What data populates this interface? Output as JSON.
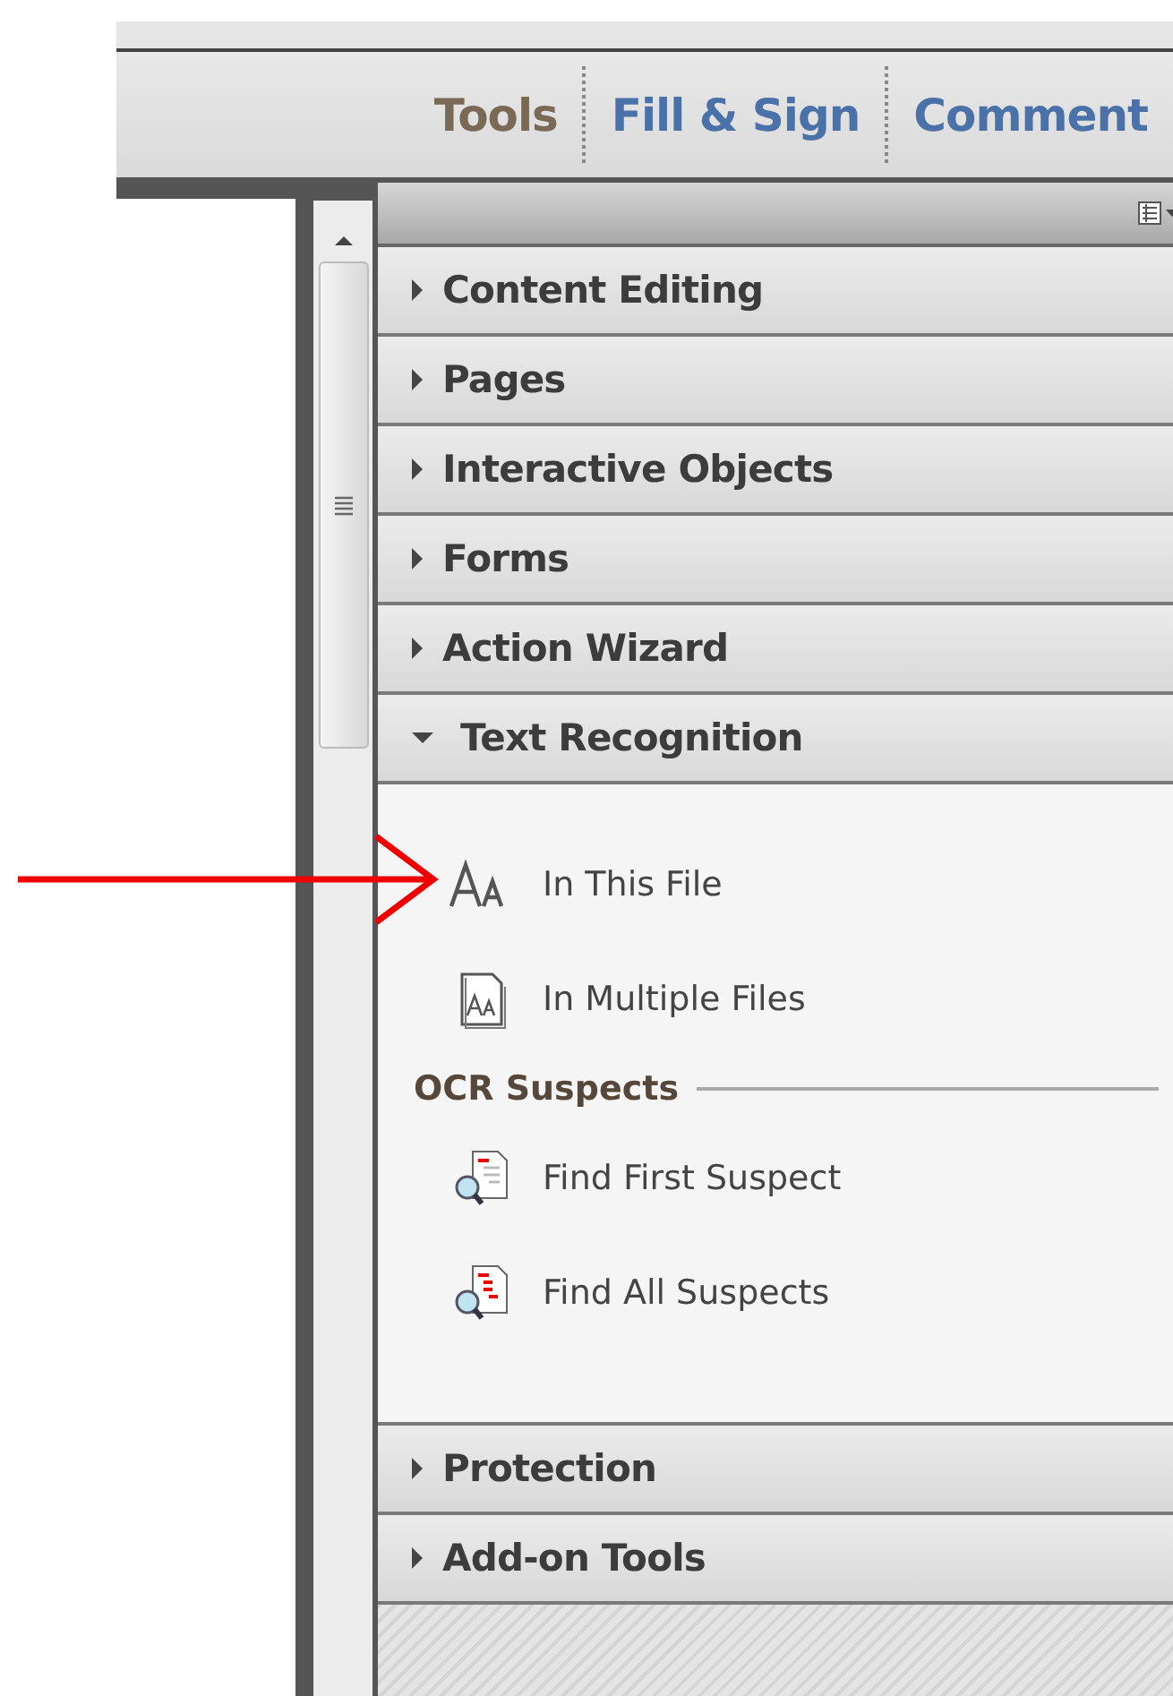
{
  "tabs": [
    {
      "label": "Tools",
      "selected": true
    },
    {
      "label": "Fill & Sign",
      "selected": false
    },
    {
      "label": "Comment",
      "selected": false
    }
  ],
  "panels": [
    {
      "title": "Content Editing",
      "expanded": false
    },
    {
      "title": "Pages",
      "expanded": false
    },
    {
      "title": "Interactive Objects",
      "expanded": false
    },
    {
      "title": "Forms",
      "expanded": false
    },
    {
      "title": "Action Wizard",
      "expanded": false
    },
    {
      "title": "Text Recognition",
      "expanded": true,
      "items": [
        {
          "kind": "tool",
          "label": "In This File"
        },
        {
          "kind": "tool",
          "label": "In Multiple Files"
        },
        {
          "kind": "heading",
          "label": "OCR Suspects"
        },
        {
          "kind": "tool",
          "label": "Find First Suspect"
        },
        {
          "kind": "tool",
          "label": "Find All Suspects"
        }
      ]
    },
    {
      "title": "Protection",
      "expanded": false
    },
    {
      "title": "Add-on Tools",
      "expanded": false
    }
  ]
}
